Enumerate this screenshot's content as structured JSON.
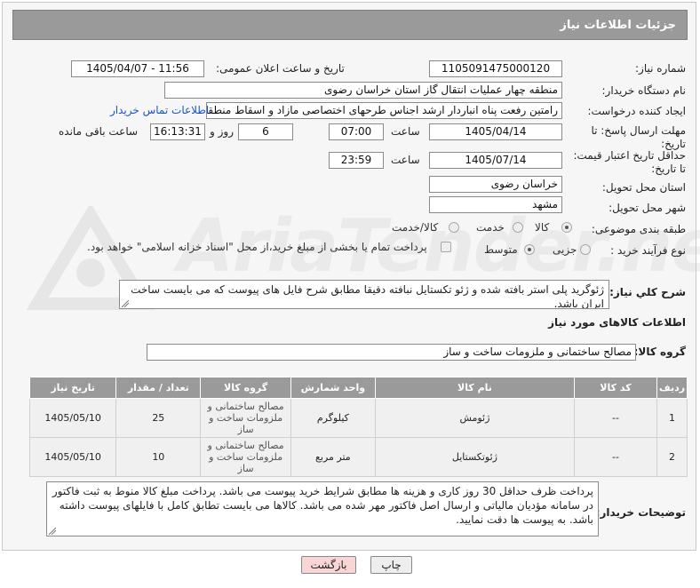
{
  "header": {
    "title": "جزئیات اطلاعات نیاز"
  },
  "labels": {
    "need_number": "شماره نیاز:",
    "announce_datetime": "تاریخ و ساعت اعلان عمومی:",
    "buyer_org": "نام دستگاه خریدار:",
    "requester": "ایجاد کننده درخواست:",
    "deadline_send": "مهلت ارسال پاسخ: تا تاریخ:",
    "time": "ساعت",
    "day_and": "روز و",
    "hours_left": "ساعت باقی مانده",
    "min_validity": "حداقل تاریخ اعتبار قیمت: تا تاریخ:",
    "time2": "ساعت",
    "province": "استان محل تحویل:",
    "city": "شهر محل تحویل:",
    "category": "طبقه بندی موضوعی:",
    "purchase_type": "نوع فرآیند خرید :",
    "description": "شرح کلي نياز:",
    "goods_info": "اطلاعات کالاهای مورد نیاز",
    "goods_group": "گروه کالا:",
    "buyer_notes": "توضیحات خریدار:"
  },
  "fields": {
    "need_number": "1105091475000120",
    "announce_datetime": "1405/04/07 - 11:56",
    "buyer_org": "منطقه چهار عملیات انتقال گاز    استان خراسان رضوی",
    "requester": "رامتین رفعت پناه انباردار ارشد اجناس طرحهای اختصاصی مازاد و اسقاط منطقه چ",
    "contact_link": "اطلاعات تماس خریدار",
    "deadline_date": "1405/04/14",
    "deadline_time": "07:00",
    "days": "6",
    "remaining_time": "16:13:31",
    "validity_date": "1405/07/14",
    "validity_time": "23:59",
    "province": "خراسان رضوی",
    "city": "مشهد"
  },
  "category_options": [
    {
      "label": "کالا",
      "selected": true
    },
    {
      "label": "خدمت",
      "selected": false
    },
    {
      "label": "کالا/خدمت",
      "selected": false
    }
  ],
  "purchase_options": [
    {
      "label": "جزیی",
      "selected": false
    },
    {
      "label": "متوسط",
      "selected": true
    }
  ],
  "payment_note": "پرداخت تمام یا بخشی از مبلغ خرید،از محل \"اسناد خزانه اسلامی\" خواهد بود.",
  "description_text": "ژئوگرید پلی استر بافته شده و ژئو تکستایل نبافته دقیقا مطابق شرح فایل های پیوست که می بایست ساخت ایران باشد.",
  "goods_group_value": "مصالح ساختمانی و ملزومات ساخت و ساز",
  "table": {
    "headers": [
      "ردیف",
      "کد کالا",
      "نام کالا",
      "واحد شمارش",
      "گروه کالا",
      "تعداد / مقدار",
      "تاریخ نیاز"
    ],
    "rows": [
      {
        "row": "1",
        "code": "--",
        "name": "ژئومش",
        "unit": "کیلوگرم",
        "group": "مصالح ساختمانی و ملزومات ساخت و ساز",
        "qty": "25",
        "date": "1405/05/10"
      },
      {
        "row": "2",
        "code": "--",
        "name": "ژئوتکستایل",
        "unit": "متر مربع",
        "group": "مصالح ساختمانی و ملزومات ساخت و ساز",
        "qty": "10",
        "date": "1405/05/10"
      }
    ]
  },
  "buyer_notes_text": "پرداخت ظرف حداقل 30 روز کاری و هزینه ها مطابق شرایط خرید پیوست می باشد. پرداخت مبلغ کالا منوط به ثبت فاکتور در سامانه مؤدیان مالیاتی و ارسال اصل فاکتور مهر شده  می باشد. کالاها می بایست تطابق کامل با فایلهای پیوست داشته باشد. به پیوست ها دقت نمایید.",
  "buttons": {
    "print": "چاپ",
    "back": "بازگشت"
  },
  "watermark": "AriaTender.net",
  "colors": {
    "header": "#9a9a9a",
    "link": "#1a54c2",
    "back_button": "#f9d5d5",
    "print_button": "#eeeeee"
  }
}
